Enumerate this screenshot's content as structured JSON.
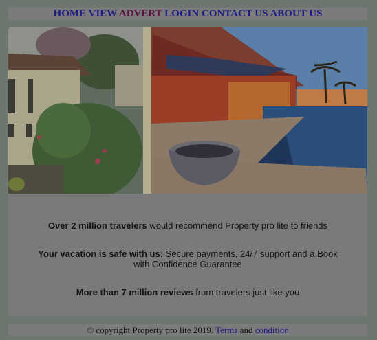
{
  "nav": {
    "items": [
      {
        "label": "HOME"
      },
      {
        "label": "VIEW"
      },
      {
        "label": "ADVERT"
      },
      {
        "label": "LOGIN"
      },
      {
        "label": "CONTACT US"
      },
      {
        "label": "ABOUT US"
      }
    ]
  },
  "features": [
    {
      "bold": "Over 2 million travelers",
      "text": " would recommend Property pro lite to friends"
    },
    {
      "bold": "Your vacation is safe with us:",
      "text": " Secure payments, 24/7 support and a Book with Confidence Guarantee"
    },
    {
      "bold": "More than 7 million reviews",
      "text": " from travelers just like you"
    }
  ],
  "footer": {
    "copyright": "© copyright Property pro lite 2019.",
    "terms_label": "Terms",
    "and": "and",
    "condition_label": "condition"
  },
  "colors": {
    "overlay_bg": "#6e7670",
    "nav_link": "#1d1a86",
    "nav_link_visited": "#5a1040"
  }
}
